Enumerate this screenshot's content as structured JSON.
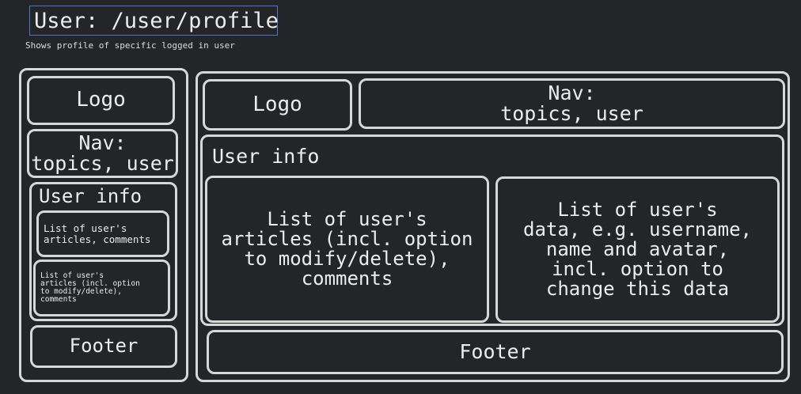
{
  "title": "User: /user/profile",
  "subtitle": "Shows profile of specific logged in user",
  "mobile": {
    "logo": "Logo",
    "nav": "Nav:\ntopics, user",
    "user_info": "User info",
    "articles_box": "List of user's\narticles, comments",
    "modify_box": "List of user's\narticles (incl. option\nto modify/delete),\ncomments",
    "footer": "Footer"
  },
  "desktop": {
    "logo": "Logo",
    "nav": "Nav:\ntopics, user",
    "user_info": "User info",
    "articles_box": "List of user's\narticles (incl. option\nto modify/delete),\ncomments",
    "data_box": "List of user's\ndata, e.g. username,\nname and avatar,\nincl. option to\nchange this data",
    "footer": "Footer"
  },
  "colors": {
    "background": "#232529",
    "stroke": "#d7d7d7",
    "title_border": "#4a78c8",
    "text": "#ececec"
  }
}
